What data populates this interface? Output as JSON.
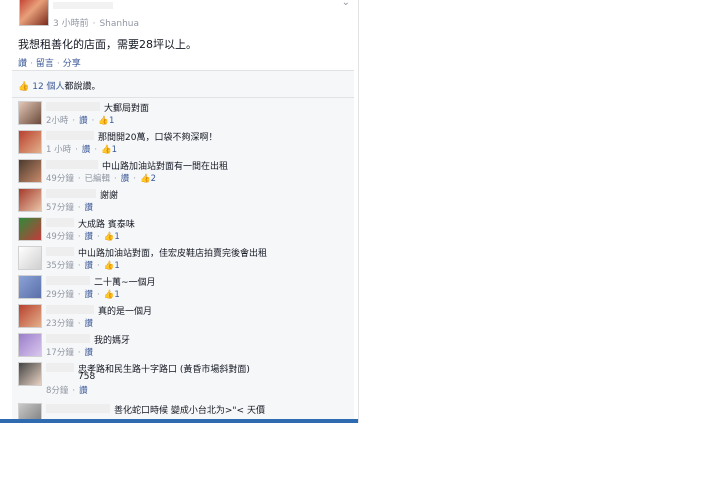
{
  "post": {
    "time": "3 小時前",
    "location": "Shanhua",
    "text": "我想租善化的店面，需要28坪以上。",
    "actions": [
      "讚",
      "留言",
      "分享"
    ],
    "chevron": "chevron-down-icon"
  },
  "likes": {
    "summary_count": "12 個人",
    "summary_rest": "都說讚。"
  },
  "labels": {
    "like": "讚",
    "edited": "已編輯"
  },
  "comments": [
    {
      "text": "大郵局對面",
      "time": "2小時",
      "likes": "1",
      "text_left": 86
    },
    {
      "text": "那間開20萬，口袋不夠深啊！",
      "time": "1 小時",
      "likes": "1",
      "text_left": 80
    },
    {
      "text": "中山路加油站對面有一間在出租",
      "time": "49分鐘",
      "edited": true,
      "likes": "2",
      "text_left": 84
    },
    {
      "text": "謝謝",
      "time": "57分鐘",
      "likes": "",
      "text_left": 82
    },
    {
      "text": "大成路 賓泰味",
      "time": "49分鐘",
      "likes": "1",
      "text_left": 60
    },
    {
      "text": "中山路加油站對面，佳宏皮鞋店拍賣完後會出租",
      "time": "35分鐘",
      "likes": "1",
      "text_left": 60
    },
    {
      "text": "二十萬~一個月",
      "time": "29分鐘",
      "likes": "1",
      "text_left": 76
    },
    {
      "text": "真的是一個月",
      "time": "23分鐘",
      "likes": "",
      "text_left": 80
    },
    {
      "text": "我的媽牙",
      "time": "17分鐘",
      "likes": "",
      "text_left": 76
    },
    {
      "text": "忠孝路和民生路十字路口 (黃昏市場斜對面)",
      "text2": "758",
      "time": "8分鐘",
      "likes": "",
      "text_left": 60
    },
    {
      "text": "善化蛇口時候 變成小台北为>\"< 天價",
      "time": "",
      "likes": "",
      "text_left": 96
    }
  ]
}
